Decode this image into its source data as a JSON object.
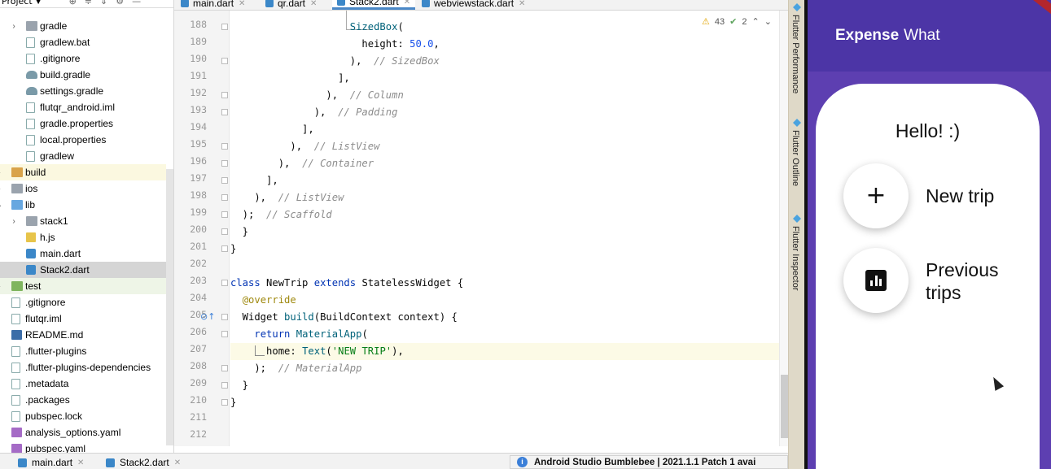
{
  "project_panel": {
    "title": "Project",
    "rows": [
      {
        "label": "gradle",
        "kind": "folder",
        "indent": 2,
        "chevron": "›"
      },
      {
        "label": "gradlew.bat",
        "kind": "file",
        "indent": 2
      },
      {
        "label": ".gitignore",
        "kind": "file",
        "indent": 2
      },
      {
        "label": "build.gradle",
        "kind": "gradle",
        "indent": 2
      },
      {
        "label": "settings.gradle",
        "kind": "gradle",
        "indent": 2
      },
      {
        "label": "flutqr_android.iml",
        "kind": "file",
        "indent": 2
      },
      {
        "label": "gradle.properties",
        "kind": "file",
        "indent": 2
      },
      {
        "label": "local.properties",
        "kind": "file",
        "indent": 2
      },
      {
        "label": "gradlew",
        "kind": "file",
        "indent": 2
      },
      {
        "label": "build",
        "kind": "folder-orange",
        "indent": 1,
        "chevron": "›",
        "style": "build"
      },
      {
        "label": "ios",
        "kind": "folder",
        "indent": 1,
        "chevron": "›"
      },
      {
        "label": "lib",
        "kind": "folder-blue",
        "indent": 1,
        "chevron": "⌄"
      },
      {
        "label": "stack1",
        "kind": "folder",
        "indent": 2,
        "chevron": "›"
      },
      {
        "label": "h.js",
        "kind": "js",
        "indent": 2
      },
      {
        "label": "main.dart",
        "kind": "dart",
        "indent": 2
      },
      {
        "label": "Stack2.dart",
        "kind": "dart",
        "indent": 2,
        "style": "sel"
      },
      {
        "label": "test",
        "kind": "folder-green",
        "indent": 1,
        "chevron": "›",
        "style": "testbg"
      },
      {
        "label": ".gitignore",
        "kind": "file",
        "indent": 1
      },
      {
        "label": "flutqr.iml",
        "kind": "file",
        "indent": 1
      },
      {
        "label": "README.md",
        "kind": "md",
        "indent": 1
      },
      {
        "label": ".flutter-plugins",
        "kind": "file",
        "indent": 1
      },
      {
        "label": ".flutter-plugins-dependencies",
        "kind": "file",
        "indent": 1
      },
      {
        "label": ".metadata",
        "kind": "file",
        "indent": 1
      },
      {
        "label": ".packages",
        "kind": "file",
        "indent": 1
      },
      {
        "label": "pubspec.lock",
        "kind": "file",
        "indent": 1
      },
      {
        "label": "analysis_options.yaml",
        "kind": "yml",
        "indent": 1
      },
      {
        "label": "pubspec.yaml",
        "kind": "yml",
        "indent": 1
      }
    ]
  },
  "editor_tabs": [
    {
      "label": "main.dart"
    },
    {
      "label": "qr.dart"
    },
    {
      "label": "Stack2.dart",
      "active": true
    },
    {
      "label": "webviewstack.dart"
    }
  ],
  "inspections": {
    "warnings": "43",
    "weak_warnings": "2"
  },
  "line_numbers": [
    "188",
    "189",
    "190",
    "191",
    "192",
    "193",
    "194",
    "195",
    "196",
    "197",
    "198",
    "199",
    "200",
    "201",
    "202",
    "203",
    "204",
    "205",
    "206",
    "207",
    "208",
    "209",
    "210",
    "211",
    "212"
  ],
  "code_lines": [
    [
      {
        "t": "                    "
      },
      {
        "t": "SizedBox",
        "c": "ty"
      },
      {
        "t": "("
      }
    ],
    [
      {
        "t": "                      height: "
      },
      {
        "t": "50.0",
        "c": "num"
      },
      {
        "t": ","
      }
    ],
    [
      {
        "t": "                    ),  "
      },
      {
        "t": "// SizedBox",
        "c": "cm"
      }
    ],
    [
      {
        "t": "                  ],"
      }
    ],
    [
      {
        "t": "                ),  "
      },
      {
        "t": "// Column",
        "c": "cm"
      }
    ],
    [
      {
        "t": "              ),  "
      },
      {
        "t": "// Padding",
        "c": "cm"
      }
    ],
    [
      {
        "t": "            ],"
      }
    ],
    [
      {
        "t": "          ),  "
      },
      {
        "t": "// ListView",
        "c": "cm"
      }
    ],
    [
      {
        "t": "        ),  "
      },
      {
        "t": "// Container",
        "c": "cm"
      }
    ],
    [
      {
        "t": "      ],"
      }
    ],
    [
      {
        "t": "    ),  "
      },
      {
        "t": "// ListView",
        "c": "cm"
      }
    ],
    [
      {
        "t": "  );  "
      },
      {
        "t": "// Scaffold",
        "c": "cm"
      }
    ],
    [
      {
        "t": "  }"
      }
    ],
    [
      {
        "t": "}"
      }
    ],
    [
      {
        "t": ""
      }
    ],
    [
      {
        "t": "class",
        "c": "kw"
      },
      {
        "t": " NewTrip "
      },
      {
        "t": "extends",
        "c": "kw"
      },
      {
        "t": " StatelessWidget {"
      }
    ],
    [
      {
        "t": "  "
      },
      {
        "t": "@override",
        "c": "ann"
      }
    ],
    [
      {
        "t": "  Widget "
      },
      {
        "t": "build",
        "c": "ty"
      },
      {
        "t": "(BuildContext context) {"
      }
    ],
    [
      {
        "t": "    "
      },
      {
        "t": "return",
        "c": "kw"
      },
      {
        "t": " "
      },
      {
        "t": "MaterialApp",
        "c": "ty"
      },
      {
        "t": "("
      }
    ],
    [
      {
        "t": "      home: "
      },
      {
        "t": "Text",
        "c": "ty"
      },
      {
        "t": "("
      },
      {
        "t": "'NEW TRIP'",
        "c": "str"
      },
      {
        "t": "),"
      }
    ],
    [
      {
        "t": "    );  "
      },
      {
        "t": "// MaterialApp",
        "c": "cm"
      }
    ],
    [
      {
        "t": "  }"
      }
    ],
    [
      {
        "t": "}"
      }
    ],
    [
      {
        "t": ""
      }
    ],
    [
      {
        "t": ""
      }
    ]
  ],
  "tool_strip": [
    "Flutter Performance",
    "Flutter Outline",
    "Flutter Inspector"
  ],
  "emulator": {
    "title_bold": "Expense",
    "title_rest": "What",
    "greeting": "Hello! :)",
    "new_trip_label": "New trip",
    "previous_trips_label_1": "Previous",
    "previous_trips_label_2": "trips",
    "colors": {
      "primary": "#5d3fb1",
      "appbar": "#4c35a6"
    }
  },
  "bottom_tabs": [
    {
      "label": "main.dart"
    },
    {
      "label": "Stack2.dart"
    }
  ],
  "notification": "Android Studio Bumblebee | 2021.1.1 Patch 1 avai"
}
